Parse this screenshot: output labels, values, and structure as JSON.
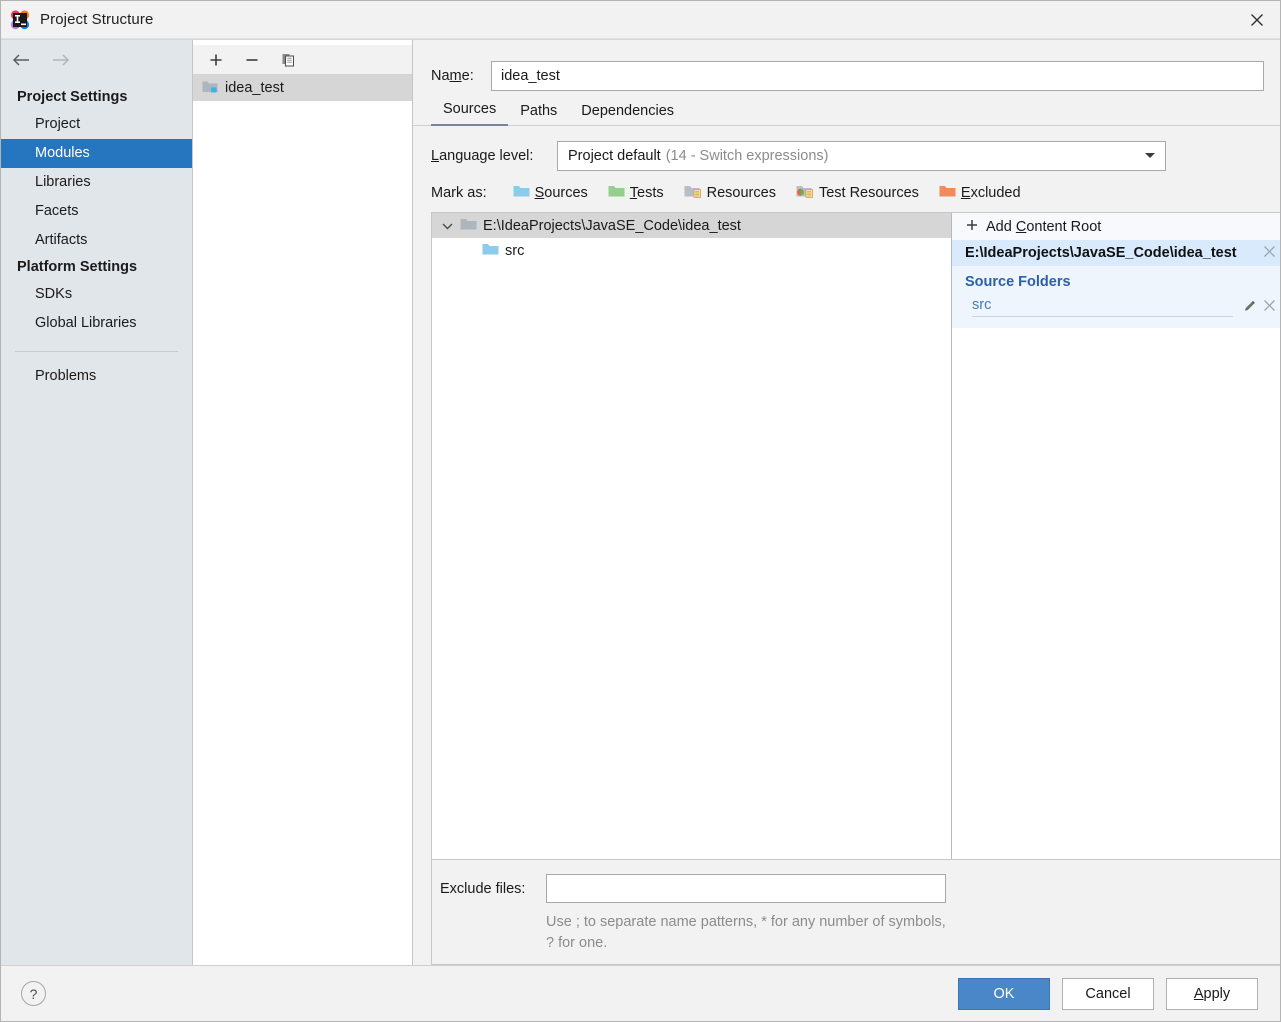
{
  "window": {
    "title": "Project Structure",
    "app_icon": "intellij-idea-icon",
    "close_label": "✕"
  },
  "sidebar": {
    "back_icon": "back-arrow-icon",
    "forward_icon": "forward-arrow-icon",
    "groups": [
      {
        "label": "Project Settings",
        "items": [
          {
            "label": "Project",
            "selected": false
          },
          {
            "label": "Modules",
            "selected": true
          },
          {
            "label": "Libraries",
            "selected": false
          },
          {
            "label": "Facets",
            "selected": false
          },
          {
            "label": "Artifacts",
            "selected": false
          }
        ]
      },
      {
        "label": "Platform Settings",
        "items": [
          {
            "label": "SDKs",
            "selected": false
          },
          {
            "label": "Global Libraries",
            "selected": false
          }
        ]
      }
    ],
    "extra_items": [
      {
        "label": "Problems",
        "selected": false
      }
    ],
    "selected_color": "#2675bf"
  },
  "modules": {
    "toolbar": {
      "add_label": "+",
      "remove_label": "−",
      "copy_label": "copy-icon"
    },
    "items": [
      {
        "label": "idea_test",
        "selected": true,
        "icon": "module-folder-icon"
      }
    ]
  },
  "main": {
    "name_label": "Name:",
    "name_mnemonic": "m",
    "name_value": "idea_test",
    "name_placeholder": "",
    "tabs": [
      {
        "label": "Sources",
        "active": true
      },
      {
        "label": "Paths",
        "active": false
      },
      {
        "label": "Dependencies",
        "active": false
      }
    ],
    "language_level": {
      "label": "Language level:",
      "value": "Project default",
      "detail": "(14 - Switch expressions)",
      "arrow_icon": "chevron-down-icon"
    },
    "mark_as": {
      "label": "Mark as:",
      "options": [
        {
          "label": "Sources",
          "mnemonic": "S",
          "rest": "ources",
          "color": "#8cccea",
          "icon": "sources-folder-icon"
        },
        {
          "label": "Tests",
          "mnemonic": "T",
          "rest": "ests",
          "color": "#94cf8e",
          "icon": "tests-folder-icon"
        },
        {
          "label": "Resources",
          "mnemonic": "",
          "rest": "Resources",
          "color": "#b6bec6",
          "icon": "resources-folder-icon"
        },
        {
          "label": "Test Resources",
          "mnemonic": "",
          "rest": "Test Resources",
          "color": "#b6bec6",
          "icon": "test-resources-folder-icon"
        },
        {
          "label": "Excluded",
          "mnemonic": "E",
          "rest": "xcluded",
          "color": "#ef8b5c",
          "icon": "excluded-folder-icon"
        }
      ]
    },
    "tree": [
      {
        "label": "E:\\IdeaProjects\\JavaSE_Code\\idea_test",
        "selected": true,
        "expanded": true,
        "icon": "content-root-folder-icon",
        "level": 0
      },
      {
        "label": "src",
        "selected": false,
        "expanded": false,
        "icon": "sources-folder-icon",
        "level": 1
      }
    ],
    "exclude": {
      "label": "Exclude files:",
      "value": "",
      "placeholder": "",
      "hint": "Use ; to separate name patterns, * for any number of symbols, ? for one."
    }
  },
  "right_panel": {
    "add_content_root": "Add Content Root",
    "add_content_root_mnemonic": "C",
    "add_icon": "plus-icon",
    "content_root": {
      "path": "E:\\IdeaProjects\\JavaSE_Code\\idea_test",
      "remove_icon": "close-icon"
    },
    "source_folders_title": "Source Folders",
    "source_folders": [
      {
        "name": "src",
        "edit_icon": "pencil-icon",
        "remove_icon": "close-icon"
      }
    ]
  },
  "footer": {
    "help_label": "?",
    "buttons": [
      {
        "label": "OK",
        "primary": true,
        "mnemonic": ""
      },
      {
        "label": "Cancel",
        "primary": false,
        "mnemonic": ""
      },
      {
        "label": "Apply",
        "primary": false,
        "mnemonic": "A"
      }
    ],
    "primary_color": "#4a87c8"
  }
}
